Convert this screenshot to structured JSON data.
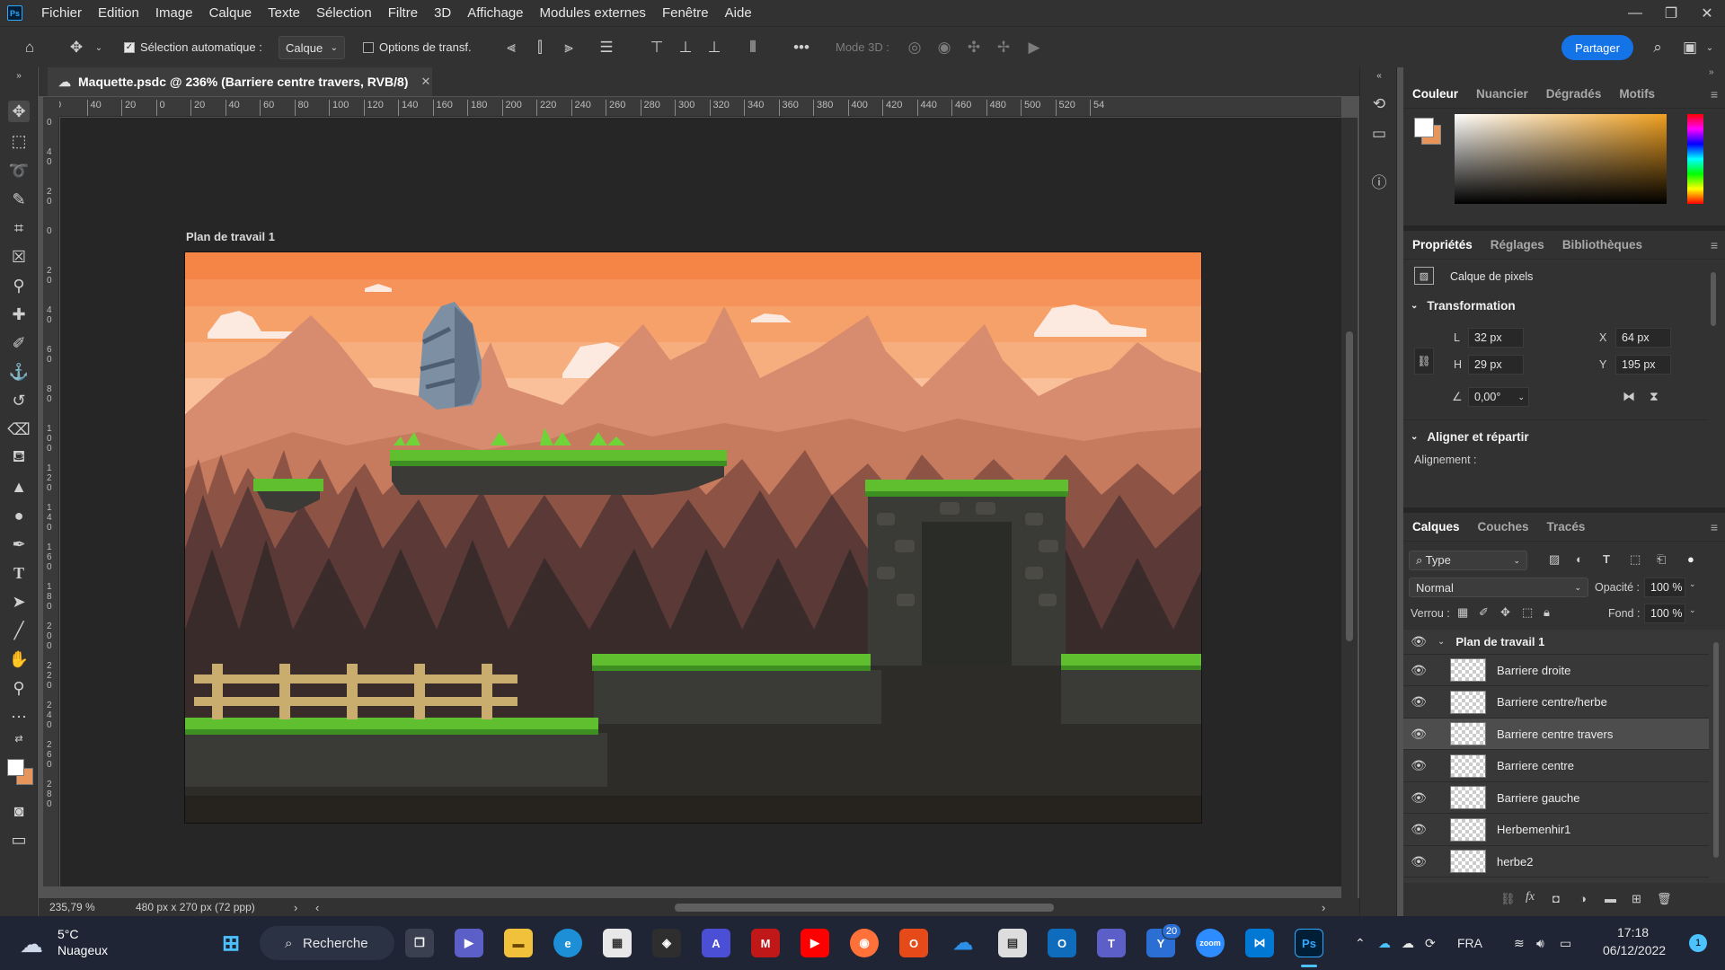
{
  "app": {
    "menu": [
      "Fichier",
      "Edition",
      "Image",
      "Calque",
      "Texte",
      "Sélection",
      "Filtre",
      "3D",
      "Affichage",
      "Modules externes",
      "Fenêtre",
      "Aide"
    ]
  },
  "options": {
    "auto_select_label": "Sélection automatique :",
    "auto_select_checked": true,
    "auto_select_target": "Calque",
    "transform_label": "Options de transf.",
    "mode3d_label": "Mode 3D :",
    "share_label": "Partager"
  },
  "document": {
    "tab_title": "Maquette.psdc @ 236% (Barriere centre travers, RVB/8)",
    "artboard_label": "Plan de travail 1",
    "ruler_h": [
      "0",
      "40",
      "20",
      "0",
      "20",
      "40",
      "60",
      "80",
      "100",
      "120",
      "140",
      "160",
      "180",
      "200",
      "220",
      "240",
      "260",
      "280",
      "300",
      "320",
      "340",
      "360",
      "380",
      "400",
      "420",
      "440",
      "460",
      "480",
      "500",
      "520",
      "54"
    ],
    "ruler_v": [
      "6 0",
      "4 0",
      "2 0",
      "0",
      "2 0",
      "4 0",
      "6 0",
      "8 0",
      "1 0 0",
      "1 2 0",
      "1 4 0",
      "1 6 0",
      "1 8 0",
      "2 0 0",
      "2 2 0",
      "2 4 0",
      "2 6 0",
      "2 8 0"
    ],
    "zoom": "235,79 %",
    "doc_info": "480 px x 270 px (72 ppp)"
  },
  "color_panel": {
    "tabs": [
      "Couleur",
      "Nuancier",
      "Dégradés",
      "Motifs"
    ],
    "foreground": "#ffffff",
    "background": "#e8955c"
  },
  "properties_panel": {
    "tabs": [
      "Propriétés",
      "Réglages",
      "Bibliothèques"
    ],
    "layer_type": "Calque de pixels",
    "transform_title": "Transformation",
    "w_label": "L",
    "w_value": "32 px",
    "h_label": "H",
    "h_value": "29 px",
    "x_label": "X",
    "x_value": "64 px",
    "y_label": "Y",
    "y_value": "195 px",
    "angle_value": "0,00°",
    "align_title": "Aligner et répartir",
    "align_label": "Alignement :"
  },
  "layers_panel": {
    "tabs": [
      "Calques",
      "Couches",
      "Tracés"
    ],
    "filter_label": "Type",
    "blend_mode": "Normal",
    "opacity_label": "Opacité :",
    "opacity_value": "100 %",
    "lock_label": "Verrou :",
    "fill_label": "Fond :",
    "fill_value": "100 %",
    "group_name": "Plan de travail 1",
    "layers": [
      {
        "name": "Barriere droite",
        "selected": false
      },
      {
        "name": "Barriere centre/herbe",
        "selected": false
      },
      {
        "name": "Barriere centre travers",
        "selected": true
      },
      {
        "name": "Barriere centre",
        "selected": false
      },
      {
        "name": "Barriere gauche",
        "selected": false
      },
      {
        "name": "Herbemenhir1",
        "selected": false
      },
      {
        "name": "herbe2",
        "selected": false
      }
    ]
  },
  "taskbar": {
    "weather_temp": "5°C",
    "weather_desc": "Nuageux",
    "search_label": "Recherche",
    "badge_count": "20",
    "language": "FRA",
    "time": "17:18",
    "date": "06/12/2022",
    "notification_count": "1"
  }
}
